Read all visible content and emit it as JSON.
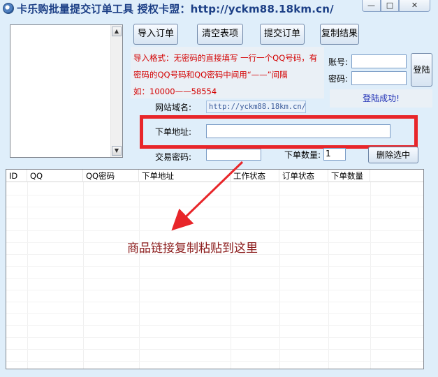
{
  "window": {
    "title": "卡乐购批量提交订单工具 授权卡盟：http://yckm88.18km.cn/",
    "min_glyph": "—",
    "max_glyph": "□",
    "close_glyph": "✕"
  },
  "toolbar": {
    "import_label": "导入订单",
    "clear_label": "清空表项",
    "submit_label": "提交订单",
    "copy_label": "复制结果"
  },
  "info": {
    "line1": "导入格式：无密码的直接填写 一行一个QQ号码，有",
    "line2": "密码的QQ号码和QQ密码中间用“——”间隔",
    "line3": "如：10000——58554"
  },
  "login": {
    "account_label": "账号:",
    "account_value": "",
    "password_label": "密码:",
    "password_value": "",
    "login_label": "登陆",
    "status": "登陆成功!"
  },
  "site": {
    "label": "网站域名:",
    "value": "http://yckm88.18km.cn/"
  },
  "order": {
    "address_label": "下单地址:",
    "address_value": "",
    "trade_pwd_label": "交易密码:",
    "trade_pwd_value": "",
    "qty_label": "下单数量:",
    "qty_value": "1",
    "delete_label": "删除选中"
  },
  "table": {
    "columns": [
      "ID",
      "QQ",
      "QQ密码",
      "下单地址",
      "工作状态",
      "订单状态",
      "下单数量"
    ],
    "rows": []
  },
  "annotation": {
    "text": "商品链接复制粘贴到这里",
    "color": "#8b1b1b",
    "frame_color": "#e8262a"
  }
}
